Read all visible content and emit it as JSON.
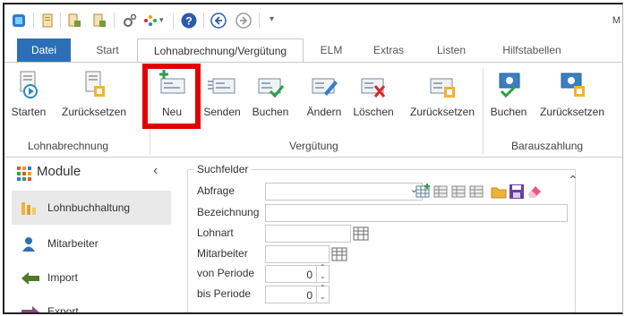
{
  "window": {
    "title_fragment": "M"
  },
  "quick_access": [
    {
      "name": "app-logo-icon",
      "color": "#2b7bd1"
    },
    {
      "name": "document-icon",
      "color": "#b88a2a"
    },
    {
      "name": "document-export-icon",
      "color": "#b88a2a"
    },
    {
      "name": "document-import-icon",
      "color": "#b88a2a"
    },
    {
      "name": "settings-gear-icon",
      "color": "#666666"
    },
    {
      "name": "colorful-dots-icon",
      "color": "#d7263d"
    },
    {
      "name": "help-icon",
      "color": "#2b5ba8"
    },
    {
      "name": "back-arrow-icon",
      "color": "#2b5ba8"
    },
    {
      "name": "forward-arrow-icon",
      "color": "#9a9a9a"
    },
    {
      "name": "customize-dropdown-icon",
      "color": "#666666"
    }
  ],
  "tabs": {
    "file": "Datei",
    "start": "Start",
    "payroll": "Lohnabrechnung/Vergütung",
    "elm": "ELM",
    "extras": "Extras",
    "lists": "Listen",
    "helptables": "Hilfstabellen"
  },
  "ribbon": {
    "starten": "Starten",
    "reset1": "Zurücksetzen",
    "neu": "Neu",
    "senden": "Senden",
    "buchen1": "Buchen",
    "aendern": "Ändern",
    "loeschen": "Löschen",
    "reset2": "Zurücksetzen",
    "buchen2": "Buchen",
    "reset3": "Zurücksetzen",
    "group_lohn": "Lohnabrechnung",
    "group_verg": "Vergütung",
    "group_bar": "Barauszahlung"
  },
  "sidebar": {
    "header": "Module",
    "items": [
      {
        "label": "Lohnbuchhaltung",
        "selected": true
      },
      {
        "label": "Mitarbeiter"
      },
      {
        "label": "Import"
      },
      {
        "label": "Export"
      }
    ]
  },
  "search": {
    "legend": "Suchfelder",
    "fields": {
      "abfrage": "Abfrage",
      "bezeichnung": "Bezeichnung",
      "lohnart": "Lohnart",
      "mitarbeiter": "Mitarbeiter",
      "von_periode": "von Periode",
      "bis_periode": "bis Periode"
    },
    "von_periode_value": "0",
    "bis_periode_value": "0"
  },
  "colors": {
    "accent": "#2b6fb6",
    "highlight": "#e00000"
  }
}
